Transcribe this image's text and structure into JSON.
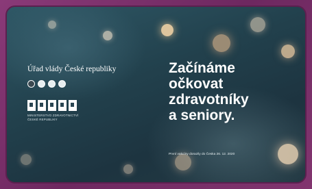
{
  "card": {
    "gov_title": "Úřad vlády České republiky",
    "ministry_caption_lines": [
      "MINISTERSTVO ZDRAVOTNICTVÍ",
      "ČESKÉ REPUBLIKY"
    ],
    "ministry_logo_text": "MZ",
    "headline_lines": [
      "Začínáme",
      "očkovat",
      "zdravotníky",
      "a seniory."
    ],
    "footnote": "První vakcíny dorazily do Česka 26. 12. 2020",
    "icons": [
      "government-emblem-icon",
      "round-emblem-icon",
      "round-emblem-icon",
      "round-emblem-icon"
    ]
  },
  "colors": {
    "frame": "#7a2f68",
    "background_teal": "#2f5866",
    "text": "#ffffff"
  }
}
